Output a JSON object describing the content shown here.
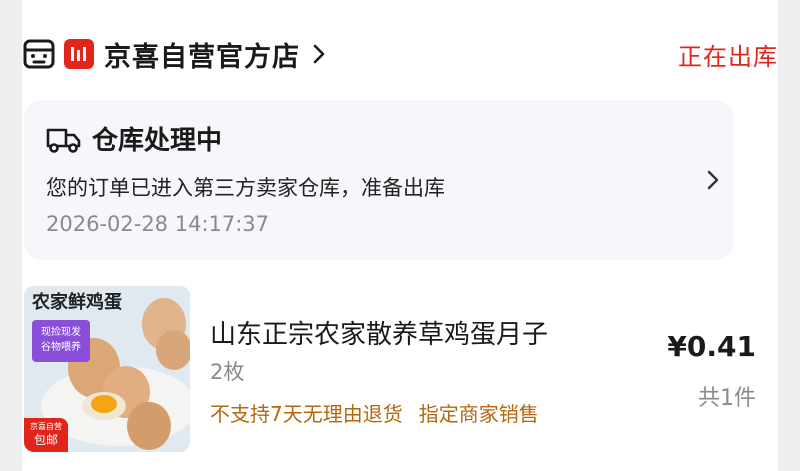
{
  "store": {
    "name": "京喜自营官方店",
    "brand_color": "#e1251b",
    "status": "正在出库"
  },
  "tracking": {
    "title": "仓库处理中",
    "description": "您的订单已进入第三方卖家仓库，准备出库",
    "time": "2026-02-28 14:17:37"
  },
  "product": {
    "image_text": "农家鲜鸡蛋",
    "image_tag": [
      "现捡现发",
      "谷物喂养"
    ],
    "image_badge": [
      "京喜自营",
      "包邮"
    ],
    "name": "山东正宗农家散养草鸡蛋月子",
    "quantity": "2枚",
    "notes": [
      "不支持7天无理由退货",
      "指定商家销售"
    ],
    "price": "¥0.41",
    "count": "共1件"
  },
  "icons": {
    "store": "store-face-icon",
    "brand": "jingxi-logo-icon",
    "chevron": "chevron-right-icon",
    "truck": "delivery-truck-icon"
  }
}
